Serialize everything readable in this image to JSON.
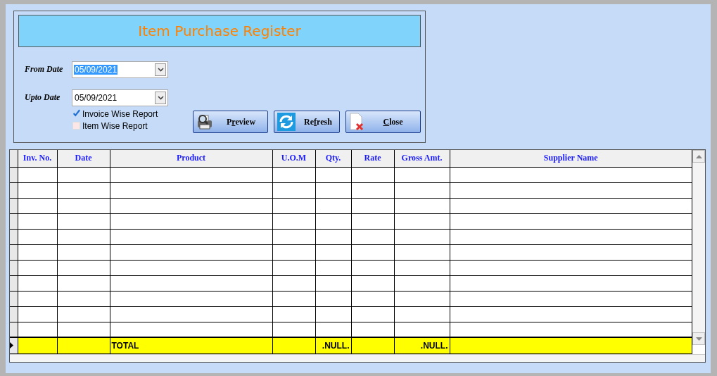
{
  "window": {
    "title": "Item Purchase Register"
  },
  "fields": [
    {
      "label": "From Date",
      "value": "05/09/2021",
      "text_selected": true
    },
    {
      "label": "Upto Date",
      "value": "05/09/2021",
      "text_selected": false
    }
  ],
  "checkboxes": [
    {
      "label": "Invoice Wise Report",
      "checked": true
    },
    {
      "label": "Item Wise Report",
      "checked": false
    }
  ],
  "buttons": [
    {
      "label_before": "P",
      "access_key": "r",
      "label_after": "eview"
    },
    {
      "label_before": "Re",
      "access_key": "f",
      "label_after": "resh"
    },
    {
      "access_key": "C",
      "label_after": "lose"
    }
  ],
  "table": {
    "columns": [
      {
        "label": "Inv. No."
      },
      {
        "label": "Date"
      },
      {
        "label": "Product",
        "total": "TOTAL"
      },
      {
        "label": "U.O.M"
      },
      {
        "label": "Qty.",
        "total": ".NULL."
      },
      {
        "label": "Rate"
      },
      {
        "label": "Gross Amt.",
        "total": ".NULL."
      },
      {
        "label": "Supplier Name"
      }
    ],
    "total_row": {
      "current": true
    }
  }
}
